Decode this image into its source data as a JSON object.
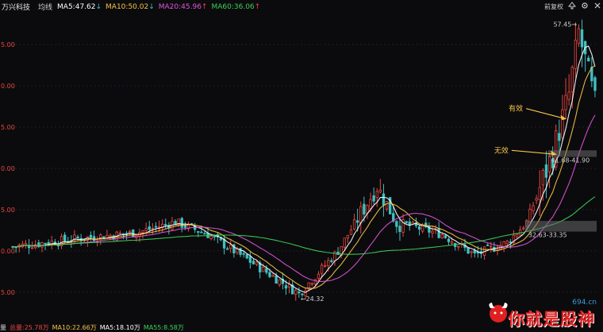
{
  "header": {
    "stock_name": "万兴科技",
    "tag": "均线",
    "ma5": {
      "label": "MA5:47.62",
      "color": "#ffffff"
    },
    "ma10": {
      "label": "MA10:50.02",
      "color": "#f6c343"
    },
    "ma20": {
      "label": "MA20:45.96",
      "color": "#e055d8"
    },
    "ma60": {
      "label": "MA60:36.06",
      "color": "#3fcf56"
    },
    "arrow_up": "↑",
    "arrow_down": "↓",
    "restore_label": "前复权",
    "arrow_icon": "arrow-up-icon",
    "gear_icon": "gear-icon",
    "close_icon": "close-icon"
  },
  "volume_bar": {
    "prefix": "量",
    "total": {
      "label": "总量:25.78万",
      "color": "#e8463d"
    },
    "ma10": {
      "label": "MA10:22.66万",
      "color": "#f6c343"
    },
    "ma5": {
      "label": "MA5:18.10万",
      "color": "#ffffff"
    },
    "ma55": {
      "label": "MA55:8.58万",
      "color": "#3fcf56"
    }
  },
  "chart_data": {
    "type": "candlestick",
    "ylim": [
      22,
      58
    ],
    "y_ticks": [
      {
        "value": 25,
        "label": "5.00"
      },
      {
        "value": 30,
        "label": "0.00"
      },
      {
        "value": 35,
        "label": "5.00"
      },
      {
        "value": 40,
        "label": "0.00"
      },
      {
        "value": 45,
        "label": "5.00"
      },
      {
        "value": 50,
        "label": "0.00"
      },
      {
        "value": 55,
        "label": "5.00"
      }
    ],
    "grid": true,
    "colors": {
      "up": "#e8463d",
      "down": "#3fc0c0"
    },
    "candles_count": 180,
    "key_prices": [
      {
        "index": 0,
        "price": 30.5
      },
      {
        "index": 20,
        "price": 31.5
      },
      {
        "index": 38,
        "price": 32.2
      },
      {
        "index": 50,
        "price": 33.5
      },
      {
        "index": 60,
        "price": 32.0
      },
      {
        "index": 72,
        "price": 29.0
      },
      {
        "index": 88,
        "price": 24.8
      },
      {
        "index": 100,
        "price": 30.0
      },
      {
        "index": 112,
        "price": 37.8
      },
      {
        "index": 118,
        "price": 33.5
      },
      {
        "index": 132,
        "price": 32.0
      },
      {
        "index": 142,
        "price": 29.5
      },
      {
        "index": 152,
        "price": 31.0
      },
      {
        "index": 158,
        "price": 33.5
      },
      {
        "index": 166,
        "price": 41.8
      },
      {
        "index": 171,
        "price": 49.0
      },
      {
        "index": 174,
        "price": 56.5
      },
      {
        "index": 179,
        "price": 47.8
      }
    ],
    "series": [
      {
        "name": "MA5",
        "color": "#ffffff"
      },
      {
        "name": "MA10",
        "color": "#f6c343"
      },
      {
        "name": "MA20",
        "color": "#e055d8"
      },
      {
        "name": "MA60",
        "color": "#3fcf56"
      }
    ],
    "max_label": {
      "text": "57.45",
      "index": 174,
      "value": 57.45
    },
    "min_label": {
      "text": "24.32",
      "index": 88,
      "value": 24.32
    },
    "zones": [
      {
        "label": "32.63-33.35",
        "low": 32.63,
        "high": 33.35,
        "from_index": 158
      },
      {
        "label": "41.68-41.90",
        "low": 41.68,
        "high": 41.9,
        "from_index": 165
      }
    ],
    "annotations": [
      {
        "text": "有效",
        "color": "#f6c343",
        "target_index": 171,
        "target_value": 46.0
      },
      {
        "text": "无效",
        "color": "#f6c343",
        "target_index": 168,
        "target_value": 41.7
      }
    ]
  },
  "watermark": {
    "domain": "694.cn",
    "brand": "你就是股神",
    "icon": "bull-logo-icon"
  }
}
